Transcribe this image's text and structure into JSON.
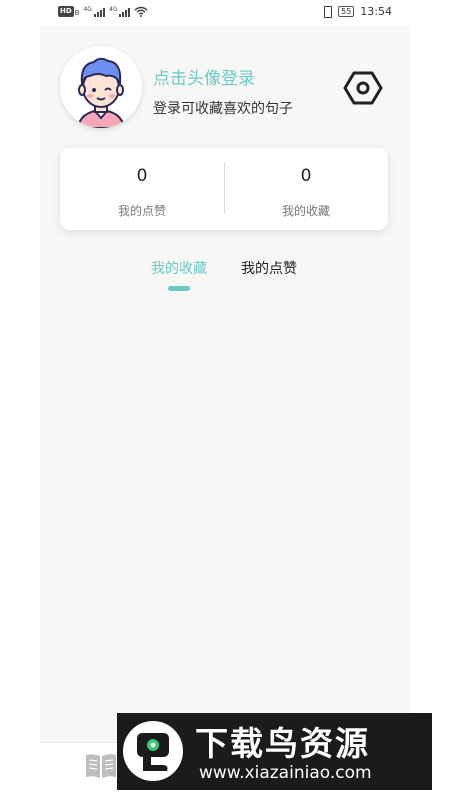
{
  "status_bar": {
    "network_badge": "HD",
    "network_sub": "B",
    "signal_gen_1": "4G",
    "signal_gen_2": "4G",
    "battery": "55",
    "time": "13:54"
  },
  "profile": {
    "login_prompt": "点击头像登录",
    "login_hint": "登录可收藏喜欢的句子"
  },
  "stats": {
    "likes_count": "0",
    "likes_label": "我的点赞",
    "favorites_count": "0",
    "favorites_label": "我的收藏"
  },
  "tabs": {
    "favorites": "我的收藏",
    "likes": "我的点赞",
    "active": "favorites"
  },
  "watermark": {
    "title": "下载鸟资源",
    "url": "www.xiazainiao.com"
  },
  "colors": {
    "accent": "#6dc8c8",
    "background": "#f7f7f5",
    "card": "#ffffff",
    "text": "#222222"
  },
  "icons": {
    "settings": "hexagon-settings-icon",
    "avatar": "cartoon-boy-avatar",
    "nav_book": "open-book-icon"
  }
}
